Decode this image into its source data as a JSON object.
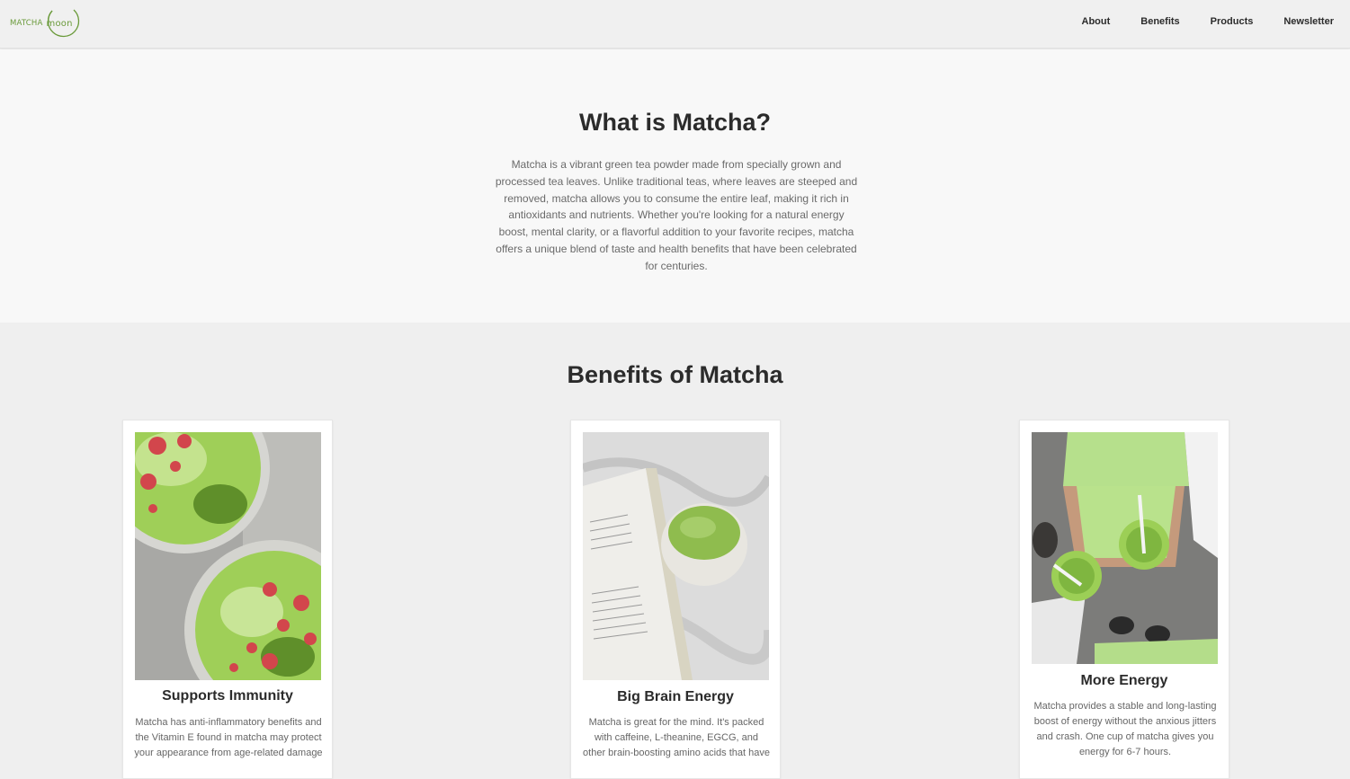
{
  "header": {
    "logo_text_left": "MATCHA",
    "logo_text_right": "moon",
    "nav": [
      {
        "label": "About"
      },
      {
        "label": "Benefits"
      },
      {
        "label": "Products"
      },
      {
        "label": "Newsletter"
      }
    ]
  },
  "intro": {
    "title": "What is Matcha?",
    "body": "Matcha is a vibrant green tea powder made from specially grown and processed tea leaves. Unlike traditional teas, where leaves are steeped and removed, matcha allows you to consume the entire leaf, making it rich in antioxidants and nutrients. Whether you're looking for a natural energy boost, mental clarity, or a flavorful addition to your favorite recipes, matcha offers a unique blend of taste and health benefits that have been celebrated for centuries."
  },
  "benefits": {
    "title": "Benefits of Matcha",
    "cards": [
      {
        "title": "Supports Immunity",
        "text": "Matcha has anti-inflammatory benefits and the Vitamin E found in matcha may protect your appearance from age-related damage"
      },
      {
        "title": "Big Brain Energy",
        "text": "Matcha is great for the mind. It's packed with caffeine, L-theanine, EGCG, and other brain-boosting amino acids that have"
      },
      {
        "title": "More Energy",
        "text": "Matcha provides a stable and long-lasting boost of energy without the anxious jitters and crash. One cup of matcha gives you energy for 6-7 hours."
      }
    ]
  },
  "colors": {
    "brand_green": "#6a9a3a",
    "matcha_green": "#8ec257"
  }
}
